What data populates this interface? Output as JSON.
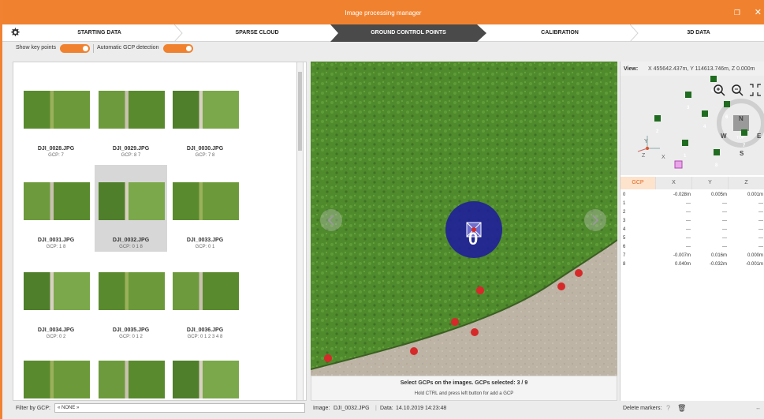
{
  "window": {
    "title": "Image processing manager"
  },
  "steps": [
    {
      "label": "STARTING DATA",
      "active": false
    },
    {
      "label": "SPARSE CLOUD",
      "active": false
    },
    {
      "label": "GROUND CONTROL POINTS",
      "active": true
    },
    {
      "label": "CALIBRATION",
      "active": false
    },
    {
      "label": "3D DATA",
      "active": false
    }
  ],
  "toolbar": {
    "show_key_points": "Show key points",
    "auto_gcp": "Automatic GCP detection"
  },
  "thumbnails": [
    {
      "name": "DJI_0028.JPG",
      "gcp": "GCP: 7"
    },
    {
      "name": "DJI_0029.JPG",
      "gcp": "GCP: 8 7"
    },
    {
      "name": "DJI_0030.JPG",
      "gcp": "GCP: 7 8"
    },
    {
      "name": "DJI_0031.JPG",
      "gcp": "GCP: 1 8"
    },
    {
      "name": "DJI_0032.JPG",
      "gcp": "GCP: 0 1 8",
      "selected": true
    },
    {
      "name": "DJI_0033.JPG",
      "gcp": "GCP: 0 1"
    },
    {
      "name": "DJI_0034.JPG",
      "gcp": "GCP: 0 2"
    },
    {
      "name": "DJI_0035.JPG",
      "gcp": "GCP: 0 1 2"
    },
    {
      "name": "DJI_0036.JPG",
      "gcp": "GCP: 0 1 2 3 4 8"
    },
    {
      "name": "",
      "gcp": ""
    },
    {
      "name": "",
      "gcp": ""
    },
    {
      "name": "",
      "gcp": ""
    }
  ],
  "filter": {
    "label": "Filter by GCP:",
    "value": "« NONE »"
  },
  "center": {
    "marker_label": "0",
    "info_line1": "Select GCPs on the images. GCPs selected: 3 / 9",
    "info_line2": "Hold CTRL and press left button for add a GCP",
    "image_label": "Image:",
    "image_value": "DJI_0032.JPG",
    "date_label": "Data:",
    "date_value": "14.10.2019 14:23:48"
  },
  "right": {
    "view_label": "View:",
    "view_value": "X 455642.437m, Y 114613.746m, Z 0.000m",
    "compass": {
      "n": "N",
      "s": "S",
      "e": "E",
      "w": "W",
      "top": "TOP"
    },
    "axes": {
      "y": "Y",
      "z": "Z",
      "x": "X"
    },
    "minimap_markers": [
      "0",
      "1",
      "2",
      "3",
      "4",
      "6",
      "7",
      "8",
      "9"
    ],
    "table_headers": [
      "GCP",
      "X",
      "Y",
      "Z"
    ],
    "rows": [
      {
        "id": "0",
        "x": "-0.028m",
        "y": "0.005m",
        "z": "0.001m"
      },
      {
        "id": "1",
        "x": "---",
        "y": "---",
        "z": "---"
      },
      {
        "id": "2",
        "x": "---",
        "y": "---",
        "z": "---"
      },
      {
        "id": "3",
        "x": "---",
        "y": "---",
        "z": "---"
      },
      {
        "id": "4",
        "x": "---",
        "y": "---",
        "z": "---"
      },
      {
        "id": "5",
        "x": "---",
        "y": "---",
        "z": "---"
      },
      {
        "id": "6",
        "x": "---",
        "y": "---",
        "z": "---"
      },
      {
        "id": "7",
        "x": "-0.007m",
        "y": "0.016m",
        "z": "0.000m"
      },
      {
        "id": "8",
        "x": "0.040m",
        "y": "-0.032m",
        "z": "-0.001m"
      }
    ],
    "delete_markers": "Delete markers:",
    "help": "?"
  },
  "colors": {
    "accent": "#f0822f",
    "active_step": "#4a4a4a",
    "gcp_marker": "#1e1e9a",
    "point": "#d62a2a"
  }
}
